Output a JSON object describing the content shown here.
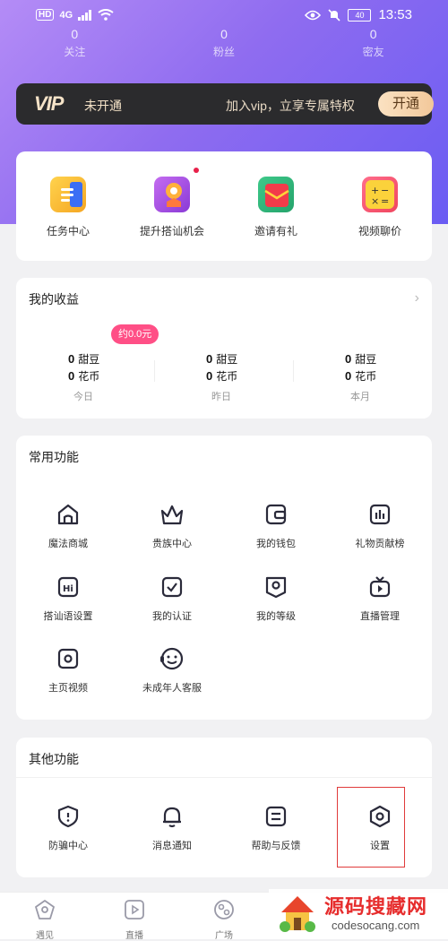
{
  "status_bar": {
    "hd": "HD",
    "network": "4G",
    "time": "13:53",
    "battery": "40"
  },
  "stats": [
    {
      "value": "0",
      "label": "关注"
    },
    {
      "value": "0",
      "label": "粉丝"
    },
    {
      "value": "0",
      "label": "密友"
    }
  ],
  "vip": {
    "logo": "VIP",
    "status": "未开通",
    "desc": "加入vip，立享专属特权",
    "button": "开通"
  },
  "quick_actions": [
    {
      "label": "任务中心",
      "icon": "task-icon",
      "color": "#f5b21f"
    },
    {
      "label": "提升搭讪机会",
      "icon": "boost-icon",
      "color": "#a94fe0",
      "badge": true
    },
    {
      "label": "邀请有礼",
      "icon": "gift-envelope-icon",
      "color": "#f2414e"
    },
    {
      "label": "视频聊价",
      "icon": "calculator-icon",
      "color": "#f6c42d"
    }
  ],
  "income": {
    "title": "我的收益",
    "pill": "约0.0元",
    "columns": [
      {
        "beans": "0",
        "beans_unit": "甜豆",
        "coins": "0",
        "coins_unit": "花币",
        "period": "今日"
      },
      {
        "beans": "0",
        "beans_unit": "甜豆",
        "coins": "0",
        "coins_unit": "花币",
        "period": "昨日"
      },
      {
        "beans": "0",
        "beans_unit": "甜豆",
        "coins": "0",
        "coins_unit": "花币",
        "period": "本月"
      }
    ]
  },
  "common": {
    "title": "常用功能",
    "items": [
      {
        "label": "魔法商城",
        "icon": "home-shop-icon"
      },
      {
        "label": "贵族中心",
        "icon": "crown-icon"
      },
      {
        "label": "我的钱包",
        "icon": "wallet-icon"
      },
      {
        "label": "礼物贡献榜",
        "icon": "chart-bars-icon"
      },
      {
        "label": "搭讪语设置",
        "icon": "hi-icon"
      },
      {
        "label": "我的认证",
        "icon": "verified-check-icon"
      },
      {
        "label": "我的等级",
        "icon": "level-badge-icon"
      },
      {
        "label": "直播管理",
        "icon": "tv-play-icon"
      },
      {
        "label": "主页视频",
        "icon": "video-square-icon"
      },
      {
        "label": "未成年人客服",
        "icon": "headset-icon"
      }
    ]
  },
  "other": {
    "title": "其他功能",
    "items": [
      {
        "label": "防骗中心",
        "icon": "shield-alert-icon"
      },
      {
        "label": "消息通知",
        "icon": "bell-icon"
      },
      {
        "label": "帮助与反馈",
        "icon": "help-doc-icon"
      },
      {
        "label": "设置",
        "icon": "settings-hex-icon"
      }
    ]
  },
  "tabs": [
    {
      "label": "遇见",
      "icon": "meet-icon"
    },
    {
      "label": "直播",
      "icon": "live-icon"
    },
    {
      "label": "广场",
      "icon": "plaza-icon"
    }
  ],
  "watermark": {
    "title": "源码搜藏网",
    "url": "codesocang.com"
  },
  "colors": {
    "accent": "#7b63f2",
    "vip_bg": "#2b2b2d",
    "pill": "#ff4f86",
    "highlight": "#e03b3b"
  }
}
